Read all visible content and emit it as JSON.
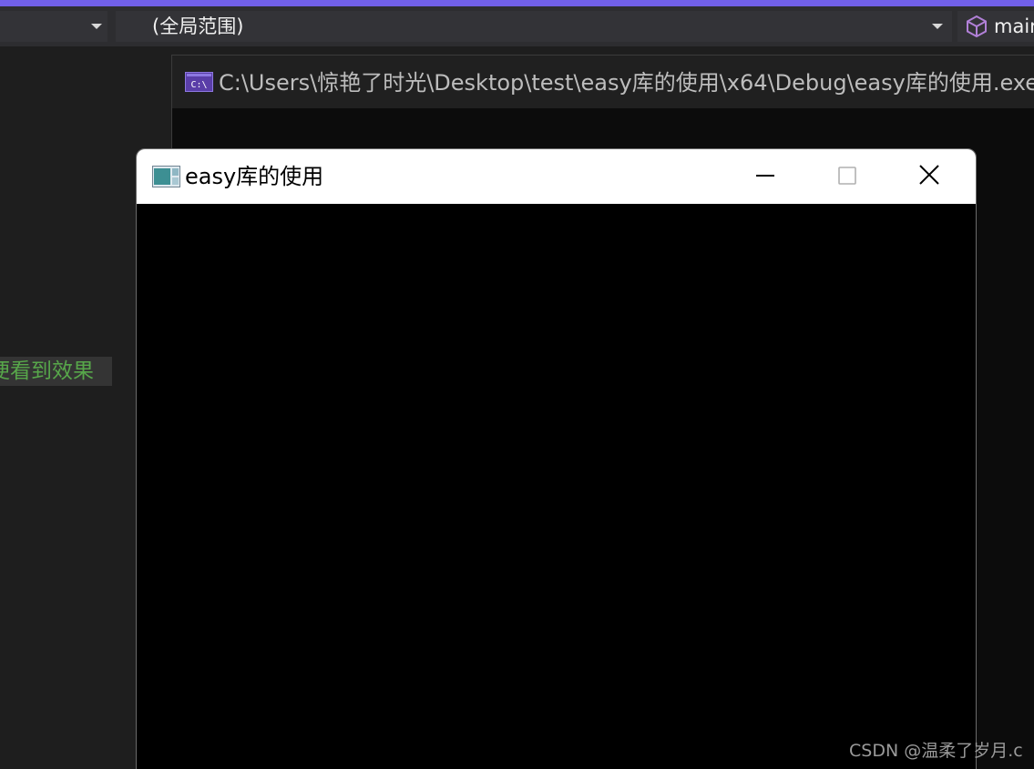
{
  "vs_toolbar": {
    "scope_dropdown": {
      "value": "(全局范围)"
    },
    "function_dropdown": {
      "value": "mair"
    }
  },
  "editor": {
    "snippet_text": "便看到效果"
  },
  "console_window": {
    "title": "C:\\Users\\惊艳了时光\\Desktop\\test\\easy库的使用\\x64\\Debug\\easy库的使用.exe"
  },
  "graphics_window": {
    "title": "easy库的使用"
  },
  "watermark": {
    "text": "CSDN @温柔了岁月.c"
  },
  "colors": {
    "accent": "#7160e8",
    "toolbar_bg": "#2d2d30",
    "editor_bg": "#1e1e1e",
    "comment_green": "#57a64a",
    "console_bg": "#0c0c0c",
    "canvas_bg": "#000000"
  },
  "icons": {
    "function_dropdown_icon": "cube-icon",
    "console_icon": "cmd-icon",
    "graphics_window_icon": "app-window-icon"
  }
}
